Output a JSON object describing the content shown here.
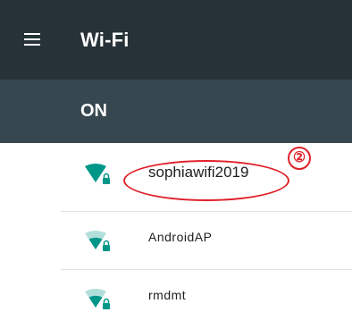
{
  "appbar": {
    "title": "Wi-Fi",
    "menu_icon": "hamburger-menu-icon",
    "background": "#263238"
  },
  "switch": {
    "label": "ON",
    "background": "#37474f"
  },
  "networks": [
    {
      "ssid": "sophiawifi2019",
      "icon": "wifi-lock-icon",
      "highlighted": true
    },
    {
      "ssid": "AndroidAP",
      "icon": "wifi-lock-icon",
      "highlighted": false
    },
    {
      "ssid": "rmdmt",
      "icon": "wifi-lock-icon",
      "highlighted": false
    }
  ],
  "annotation": {
    "step_label": "②",
    "color": "#e0202a"
  },
  "colors": {
    "wifi_icon": "#009688"
  }
}
